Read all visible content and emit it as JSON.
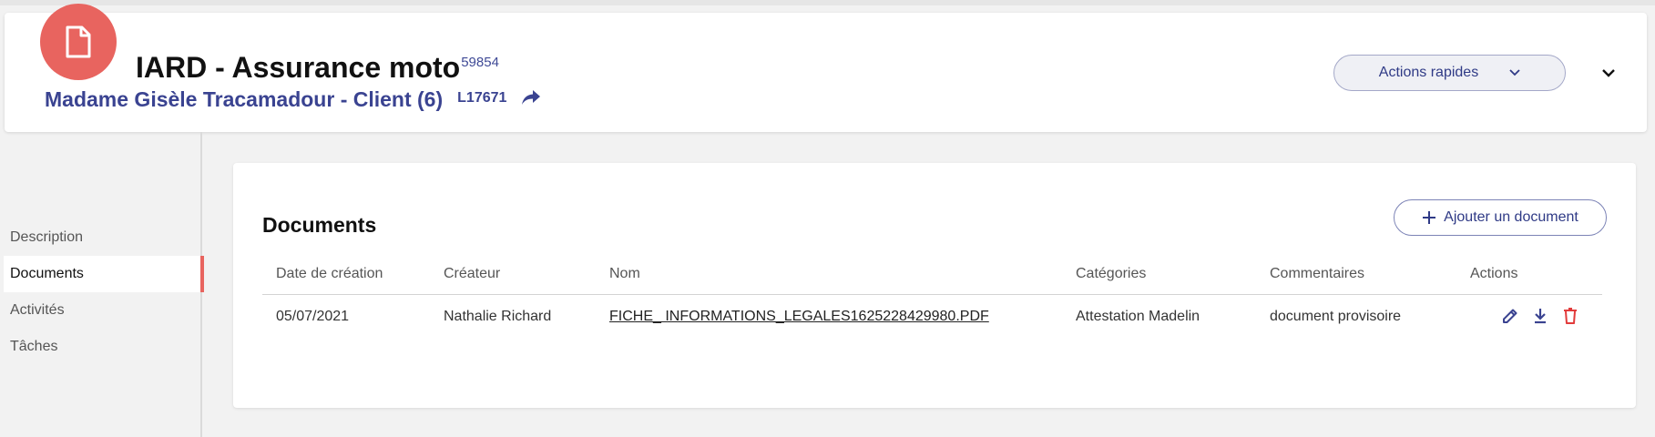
{
  "header": {
    "title": "IARD - Assurance moto",
    "title_ref": "59854",
    "client_name": "Madame Gisèle Tracamadour - Client (6)",
    "client_code": "L17671",
    "quick_actions_label": "Actions rapides"
  },
  "sidebar": {
    "items": [
      {
        "label": "Description",
        "active": false
      },
      {
        "label": "Documents",
        "active": true
      },
      {
        "label": "Activités",
        "active": false
      },
      {
        "label": "Tâches",
        "active": false
      }
    ]
  },
  "documents": {
    "title": "Documents",
    "add_button_label": "Ajouter un document",
    "columns": [
      "Date de création",
      "Créateur",
      "Nom",
      "Catégories",
      "Commentaires",
      "Actions"
    ],
    "rows": [
      {
        "date": "05/07/2021",
        "creator": "Nathalie Richard",
        "name": "FICHE_ INFORMATIONS_LEGALES1625228429980.PDF",
        "category": "Attestation Madelin",
        "comment": "document provisoire"
      }
    ]
  },
  "colors": {
    "accent_red": "#e8645f",
    "brand_blue": "#3a4391",
    "background": "#f2f2f2"
  },
  "icons": [
    "document-icon",
    "share-icon",
    "chevron-down-icon",
    "plus-icon",
    "edit-icon",
    "download-icon",
    "delete-icon"
  ]
}
